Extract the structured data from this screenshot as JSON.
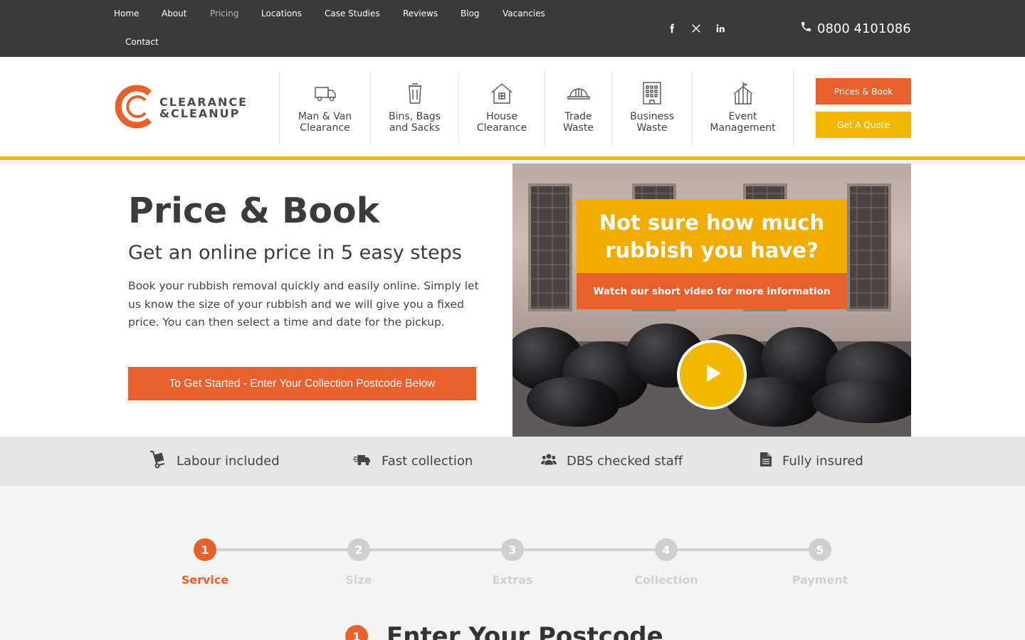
{
  "topnav": {
    "items": [
      "Home",
      "About",
      "Pricing",
      "Locations",
      "Case Studies",
      "Reviews",
      "Blog",
      "Vacancies",
      "Contact"
    ],
    "phone": "0800 4101086"
  },
  "header": {
    "logo_line1": "CLEARANCE",
    "logo_line2": "&CLEANUP",
    "services": [
      {
        "line1": "Man & Van",
        "line2": "Clearance",
        "icon": "van-icon"
      },
      {
        "line1": "Bins, Bags",
        "line2": "and Sacks",
        "icon": "bin-icon"
      },
      {
        "line1": "House",
        "line2": "Clearance",
        "icon": "house-icon"
      },
      {
        "line1": "Trade",
        "line2": "Waste",
        "icon": "hard-hat-icon"
      },
      {
        "line1": "Business",
        "line2": "Waste",
        "icon": "office-building-icon"
      },
      {
        "line1": "Event",
        "line2": "Management",
        "icon": "tent-icon"
      }
    ],
    "prices_book": "Prices & Book",
    "get_quote": "Get A Quote"
  },
  "hero": {
    "title": "Price & Book",
    "subtitle": "Get an online price in 5 easy steps",
    "body": "Book your rubbish removal quickly and easily online. Simply let us know the size of your rubbish and we will give you a fixed price. You can then select a time and date for the pickup.",
    "cta": "To Get Started - Enter Your Collection Postcode Below",
    "video": {
      "headline_1": "Not sure how much",
      "headline_2": "rubbish you have?",
      "subline": "Watch our short video for more information"
    }
  },
  "features": [
    {
      "label": "Labour included",
      "icon": "hand-truck-icon"
    },
    {
      "label": "Fast collection",
      "icon": "fast-truck-icon"
    },
    {
      "label": "DBS checked staff",
      "icon": "users-icon"
    },
    {
      "label": "Fully insured",
      "icon": "document-icon"
    }
  ],
  "steps": {
    "items": [
      {
        "num": "1",
        "label": "Service"
      },
      {
        "num": "2",
        "label": "Size"
      },
      {
        "num": "3",
        "label": "Extras"
      },
      {
        "num": "4",
        "label": "Collection"
      },
      {
        "num": "5",
        "label": "Payment"
      }
    ],
    "active_index": 0,
    "section_num": "1",
    "section_title": "Enter Your Postcode"
  },
  "colors": {
    "accent_orange": "#e8602c",
    "accent_yellow": "#f1b800",
    "topbar": "#3a3a3a"
  }
}
